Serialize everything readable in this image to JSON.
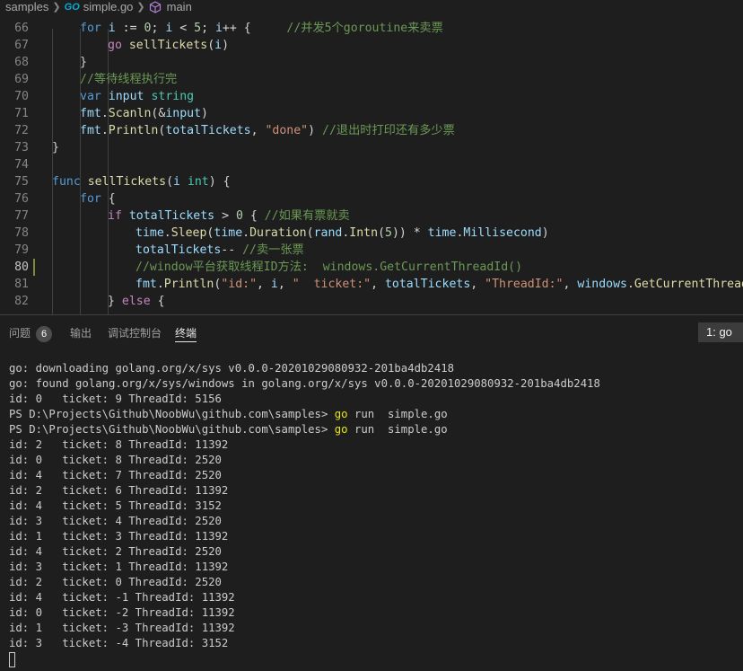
{
  "breadcrumb": {
    "folder": "samples",
    "go_badge": "GO",
    "file": "simple.go",
    "symbol": "main"
  },
  "editor": {
    "lines": [
      {
        "num": "66",
        "indent": 1,
        "tokens": [
          [
            "kw",
            "for"
          ],
          [
            "pl",
            " "
          ],
          [
            "id",
            "i"
          ],
          [
            "pl",
            " := "
          ],
          [
            "num",
            "0"
          ],
          [
            "pl",
            "; "
          ],
          [
            "id",
            "i"
          ],
          [
            "pl",
            " < "
          ],
          [
            "num",
            "5"
          ],
          [
            "pl",
            "; "
          ],
          [
            "id",
            "i"
          ],
          [
            "pl",
            "++ {     "
          ],
          [
            "cm",
            "//并发5个goroutine来卖票"
          ]
        ]
      },
      {
        "num": "67",
        "indent": 2,
        "tokens": [
          [
            "kwc",
            "go"
          ],
          [
            "pl",
            " "
          ],
          [
            "fn",
            "sellTickets"
          ],
          [
            "pl",
            "("
          ],
          [
            "id",
            "i"
          ],
          [
            "pl",
            ")"
          ]
        ]
      },
      {
        "num": "68",
        "indent": 1,
        "tokens": [
          [
            "pl",
            "}"
          ]
        ]
      },
      {
        "num": "69",
        "indent": 1,
        "tokens": [
          [
            "cm",
            "//等待线程执行完"
          ]
        ]
      },
      {
        "num": "70",
        "indent": 1,
        "tokens": [
          [
            "kw",
            "var"
          ],
          [
            "pl",
            " "
          ],
          [
            "id",
            "input"
          ],
          [
            "pl",
            " "
          ],
          [
            "ty",
            "string"
          ]
        ]
      },
      {
        "num": "71",
        "indent": 1,
        "tokens": [
          [
            "id",
            "fmt"
          ],
          [
            "pl",
            "."
          ],
          [
            "fn",
            "Scanln"
          ],
          [
            "pl",
            "(&"
          ],
          [
            "id",
            "input"
          ],
          [
            "pl",
            ")"
          ]
        ]
      },
      {
        "num": "72",
        "indent": 1,
        "tokens": [
          [
            "id",
            "fmt"
          ],
          [
            "pl",
            "."
          ],
          [
            "fn",
            "Println"
          ],
          [
            "pl",
            "("
          ],
          [
            "id",
            "totalTickets"
          ],
          [
            "pl",
            ", "
          ],
          [
            "str",
            "\"done\""
          ],
          [
            "pl",
            ") "
          ],
          [
            "cm",
            "//退出时打印还有多少票"
          ]
        ]
      },
      {
        "num": "73",
        "indent": 0,
        "tokens": [
          [
            "pl",
            "}"
          ]
        ]
      },
      {
        "num": "74",
        "indent": 0,
        "tokens": []
      },
      {
        "num": "75",
        "indent": 0,
        "tokens": [
          [
            "kw",
            "func"
          ],
          [
            "pl",
            " "
          ],
          [
            "fn",
            "sellTickets"
          ],
          [
            "pl",
            "("
          ],
          [
            "id",
            "i"
          ],
          [
            "pl",
            " "
          ],
          [
            "ty",
            "int"
          ],
          [
            "pl",
            ") {"
          ]
        ]
      },
      {
        "num": "76",
        "indent": 1,
        "tokens": [
          [
            "kw",
            "for"
          ],
          [
            "pl",
            " {"
          ]
        ]
      },
      {
        "num": "77",
        "indent": 2,
        "tokens": [
          [
            "kwc",
            "if"
          ],
          [
            "pl",
            " "
          ],
          [
            "id",
            "totalTickets"
          ],
          [
            "pl",
            " > "
          ],
          [
            "num",
            "0"
          ],
          [
            "pl",
            " { "
          ],
          [
            "cm",
            "//如果有票就卖"
          ]
        ]
      },
      {
        "num": "78",
        "indent": 3,
        "tokens": [
          [
            "id",
            "time"
          ],
          [
            "pl",
            "."
          ],
          [
            "fn",
            "Sleep"
          ],
          [
            "pl",
            "("
          ],
          [
            "id",
            "time"
          ],
          [
            "pl",
            "."
          ],
          [
            "fn",
            "Duration"
          ],
          [
            "pl",
            "("
          ],
          [
            "id",
            "rand"
          ],
          [
            "pl",
            "."
          ],
          [
            "fn",
            "Intn"
          ],
          [
            "pl",
            "("
          ],
          [
            "num",
            "5"
          ],
          [
            "pl",
            ")) * "
          ],
          [
            "id",
            "time"
          ],
          [
            "pl",
            "."
          ],
          [
            "id",
            "Millisecond"
          ],
          [
            "pl",
            ")"
          ]
        ]
      },
      {
        "num": "79",
        "indent": 3,
        "tokens": [
          [
            "id",
            "totalTickets"
          ],
          [
            "pl",
            "-- "
          ],
          [
            "cm",
            "//卖一张票"
          ]
        ]
      },
      {
        "num": "80",
        "indent": 3,
        "tokens": [
          [
            "cm",
            "//window平台获取线程ID方法:  windows.GetCurrentThreadId()"
          ]
        ]
      },
      {
        "num": "81",
        "indent": 3,
        "tokens": [
          [
            "id",
            "fmt"
          ],
          [
            "pl",
            "."
          ],
          [
            "fn",
            "Println"
          ],
          [
            "pl",
            "("
          ],
          [
            "str",
            "\"id:\""
          ],
          [
            "pl",
            ", "
          ],
          [
            "id",
            "i"
          ],
          [
            "pl",
            ", "
          ],
          [
            "str",
            "\"  ticket:\""
          ],
          [
            "pl",
            ", "
          ],
          [
            "id",
            "totalTickets"
          ],
          [
            "pl",
            ", "
          ],
          [
            "str",
            "\"ThreadId:\""
          ],
          [
            "pl",
            ", "
          ],
          [
            "id",
            "windows"
          ],
          [
            "pl",
            "."
          ],
          [
            "fn",
            "GetCurrentThreadId"
          ],
          [
            "pl",
            "()"
          ]
        ]
      },
      {
        "num": "82",
        "indent": 2,
        "tokens": [
          [
            "pl",
            "} "
          ],
          [
            "kwc",
            "else"
          ],
          [
            "pl",
            " {"
          ]
        ]
      }
    ],
    "active_line": "80",
    "modified_line": "80"
  },
  "panel": {
    "tabs": [
      {
        "label": "问题",
        "badge": "6"
      },
      {
        "label": "输出"
      },
      {
        "label": "调试控制台"
      },
      {
        "label": "终端",
        "active": true
      }
    ],
    "terminal_selector": "1: go"
  },
  "terminal": {
    "lines": [
      {
        "text": "go: downloading golang.org/x/sys v0.0.0-20201029080932-201ba4db2418"
      },
      {
        "text": "go: found golang.org/x/sys/windows in golang.org/x/sys v0.0.0-20201029080932-201ba4db2418"
      },
      {
        "text": "id: 0   ticket: 9 ThreadId: 5156"
      },
      {
        "prompt": "PS D:\\Projects\\Github\\NoobWu\\github.com\\samples> ",
        "cmd": "go",
        "rest": " run  simple.go"
      },
      {
        "prompt": "PS D:\\Projects\\Github\\NoobWu\\github.com\\samples> ",
        "cmd": "go",
        "rest": " run  simple.go"
      },
      {
        "text": "id: 2   ticket: 8 ThreadId: 11392"
      },
      {
        "text": "id: 0   ticket: 8 ThreadId: 2520"
      },
      {
        "text": "id: 4   ticket: 7 ThreadId: 2520"
      },
      {
        "text": "id: 2   ticket: 6 ThreadId: 11392"
      },
      {
        "text": "id: 4   ticket: 5 ThreadId: 3152"
      },
      {
        "text": "id: 3   ticket: 4 ThreadId: 2520"
      },
      {
        "text": "id: 1   ticket: 3 ThreadId: 11392"
      },
      {
        "text": "id: 4   ticket: 2 ThreadId: 2520"
      },
      {
        "text": "id: 3   ticket: 1 ThreadId: 11392"
      },
      {
        "text": "id: 2   ticket: 0 ThreadId: 2520"
      },
      {
        "text": "id: 4   ticket: -1 ThreadId: 11392"
      },
      {
        "text": "id: 0   ticket: -2 ThreadId: 11392"
      },
      {
        "text": "id: 1   ticket: -3 ThreadId: 11392"
      },
      {
        "text": "id: 3   ticket: -4 ThreadId: 3152"
      }
    ]
  }
}
